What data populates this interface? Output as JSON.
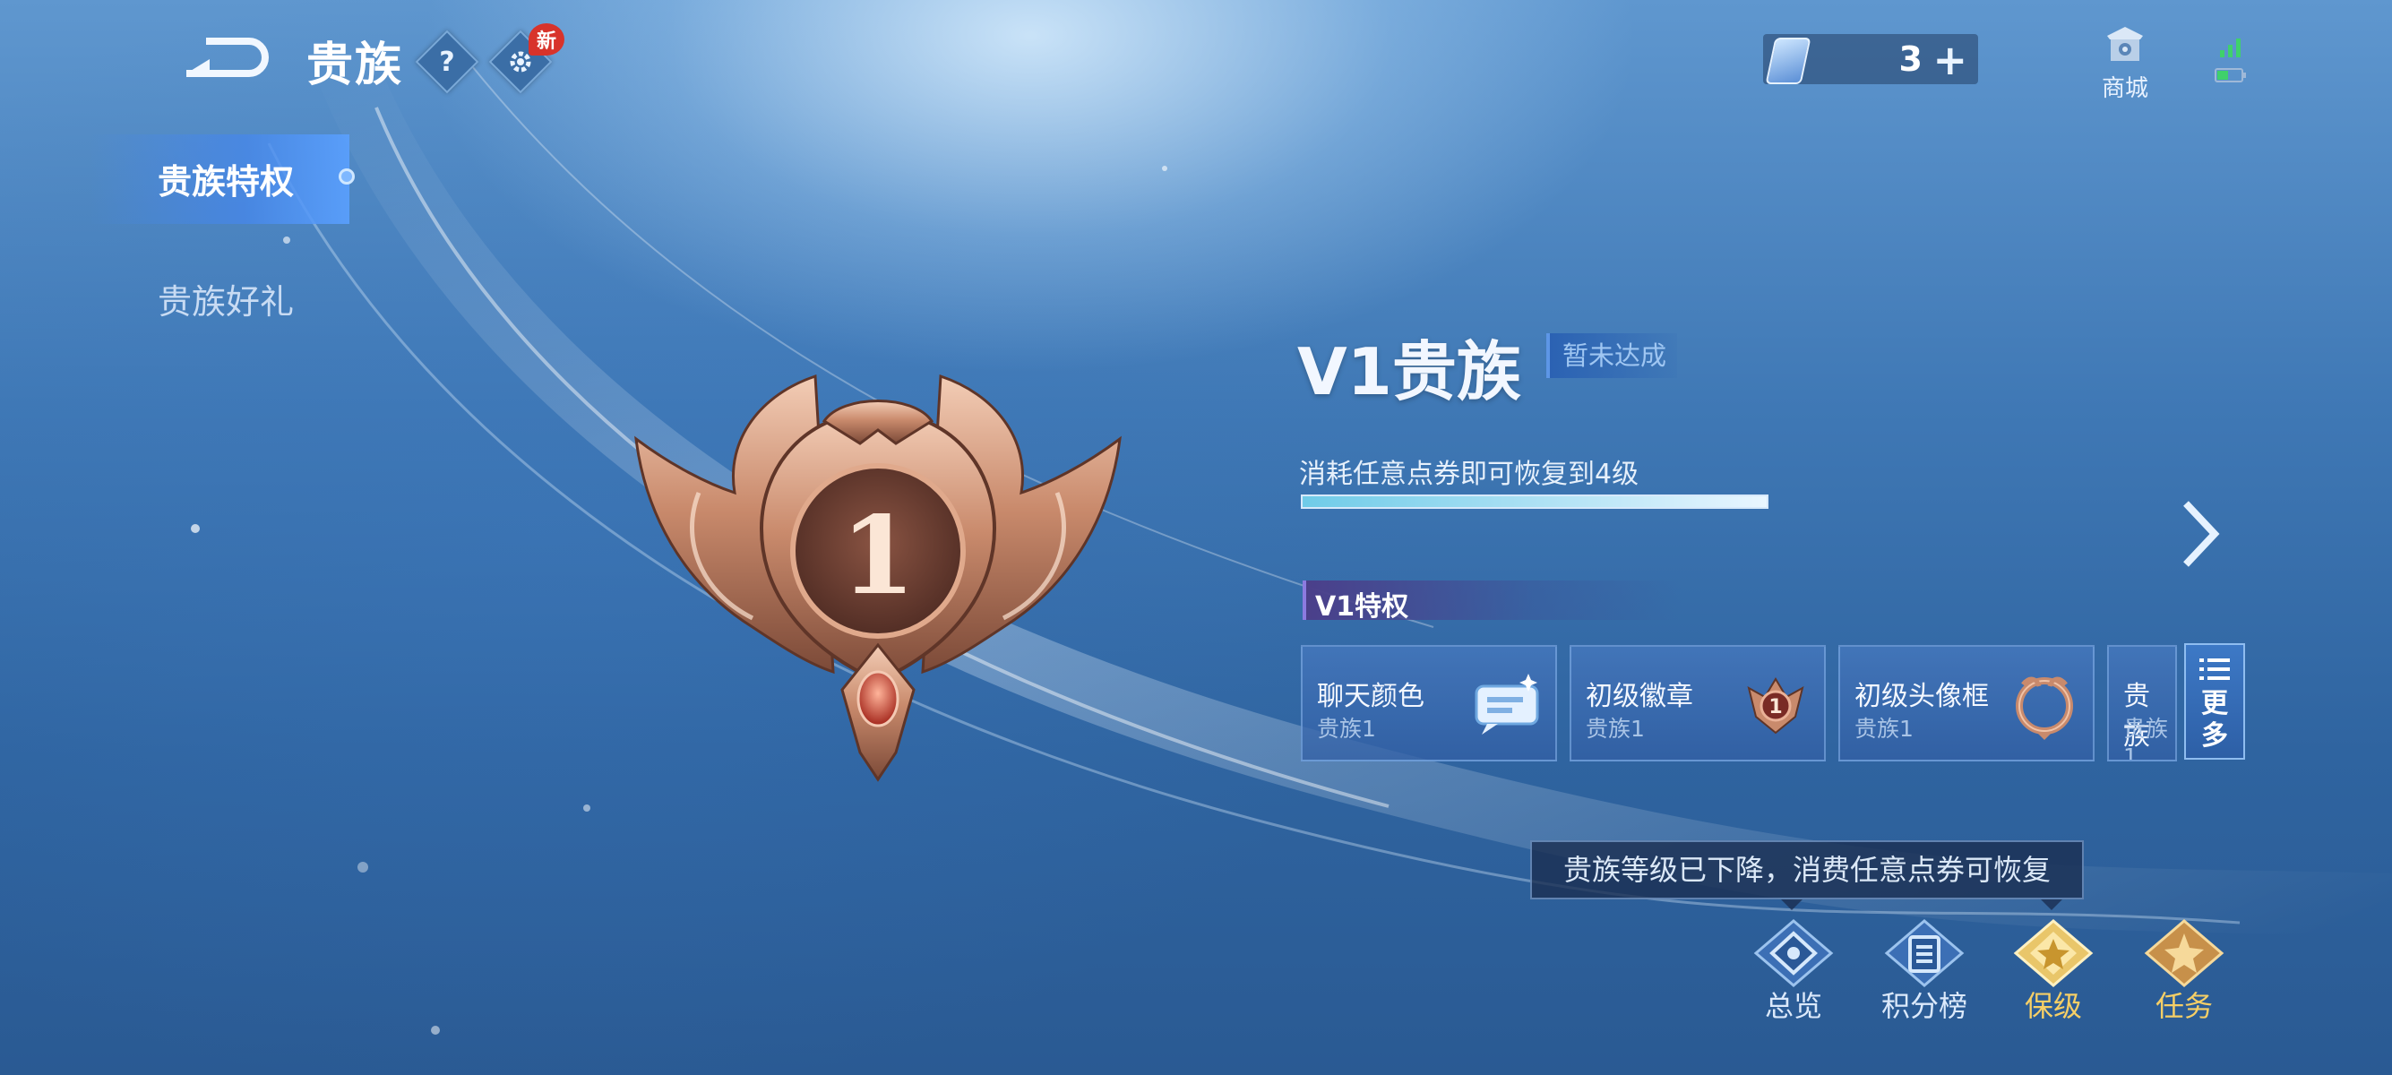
{
  "header": {
    "title": "贵族",
    "help_label": "?",
    "new_badge": "新",
    "currency": {
      "count": "3",
      "plus": "+"
    },
    "shop_label": "商城"
  },
  "sidebar": {
    "items": [
      {
        "label": "贵族特权",
        "active": true
      },
      {
        "label": "贵族好礼",
        "active": false
      }
    ]
  },
  "emblem": {
    "level_number": "1"
  },
  "level": {
    "title": "V1贵族",
    "status": "暂未达成",
    "restore_hint": "消耗任意点券即可恢复到4级",
    "progress": 1.0
  },
  "privileges": {
    "header": "V1特权",
    "cards": [
      {
        "name": "聊天颜色",
        "level": "贵族1",
        "icon": "chat-bubble-icon"
      },
      {
        "name": "初级徽章",
        "level": "贵族1",
        "icon": "badge-icon",
        "badge_number": "1"
      },
      {
        "name": "初级头像框",
        "level": "贵族1",
        "icon": "avatar-frame-icon"
      },
      {
        "name": "贵族",
        "level": "贵族1",
        "icon": ""
      }
    ],
    "more_label": "更多"
  },
  "tooltip": "贵族等级已下降，消费任意点券可恢复",
  "bottom_tabs": [
    {
      "label": "总览",
      "icon": "overview-icon"
    },
    {
      "label": "积分榜",
      "icon": "ranking-icon"
    },
    {
      "label": "保级",
      "icon": "keep-level-icon"
    },
    {
      "label": "任务",
      "icon": "task-icon"
    }
  ],
  "colors": {
    "accent_gold": "#f6cf66",
    "status_blue": "#9fc6f2",
    "new_badge_red": "#d8332b"
  }
}
